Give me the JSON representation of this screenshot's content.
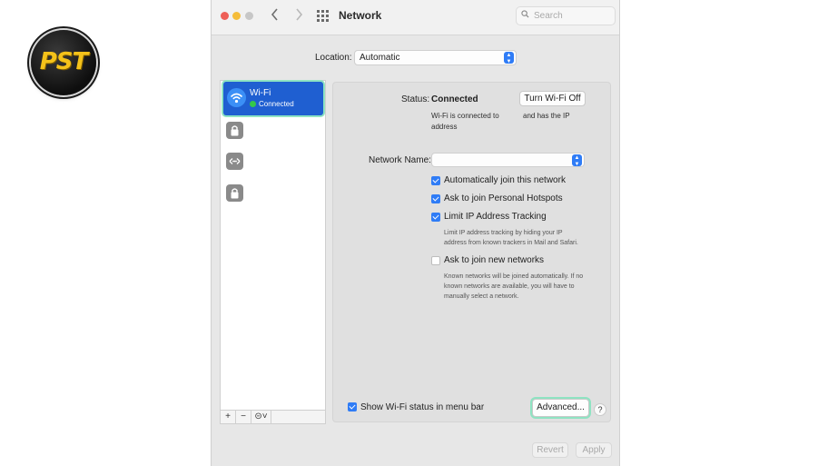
{
  "window": {
    "title": "Network"
  },
  "search": {
    "placeholder": "Search"
  },
  "location": {
    "label": "Location:",
    "value": "Automatic"
  },
  "sidebar": {
    "services": [
      {
        "name": "Wi-Fi",
        "status": "Connected",
        "selected": true,
        "icon": "wifi-icon"
      },
      {
        "name": "",
        "icon": "lock-icon"
      },
      {
        "name": "",
        "icon": "vpn-icon"
      },
      {
        "name": "",
        "icon": "lock-icon"
      }
    ],
    "tools": {
      "add": "+",
      "remove": "−",
      "action": "⊝˅"
    }
  },
  "status": {
    "label": "Status:",
    "value": "Connected",
    "toggle_button": "Turn Wi-Fi Off",
    "desc_line1": "Wi-Fi is connected to",
    "desc_line1b": "and has the IP",
    "desc_line2": "address"
  },
  "network_name": {
    "label": "Network Name:",
    "value": ""
  },
  "options": {
    "auto_join": {
      "label": "Automatically join this network",
      "checked": true
    },
    "ask_hotspots": {
      "label": "Ask to join Personal Hotspots",
      "checked": true
    },
    "limit_ip": {
      "label": "Limit IP Address Tracking",
      "checked": true,
      "help_line1": "Limit IP address tracking by hiding your IP",
      "help_line2": "address from known trackers in Mail and Safari."
    },
    "ask_new": {
      "label": "Ask to join new networks",
      "checked": false,
      "help_line1": "Known networks will be joined automatically. If no",
      "help_line2": "known networks are available, you will have to",
      "help_line3": "manually select a network."
    }
  },
  "footer": {
    "show_status": {
      "label": "Show Wi-Fi status in menu bar",
      "checked": true
    },
    "advanced": "Advanced...",
    "help": "?",
    "revert": "Revert",
    "apply": "Apply"
  },
  "logo": {
    "text": "PST"
  },
  "colors": {
    "accent": "#2f7cf6",
    "selection": "#1f5fd1",
    "highlight_ring": "#8fe3c2",
    "connected": "#35c84a"
  }
}
